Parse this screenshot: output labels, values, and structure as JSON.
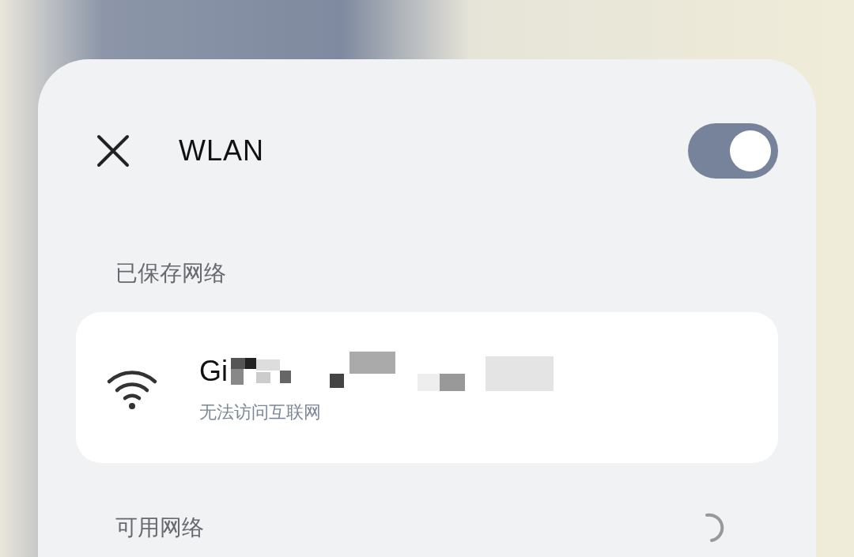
{
  "header": {
    "title": "WLAN",
    "wlan_on": true
  },
  "saved_section": {
    "heading": "已保存网络",
    "networks": [
      {
        "name": "Gi",
        "status": "无法访问互联网"
      }
    ]
  },
  "available_section": {
    "heading": "可用网络",
    "scanning": true
  }
}
